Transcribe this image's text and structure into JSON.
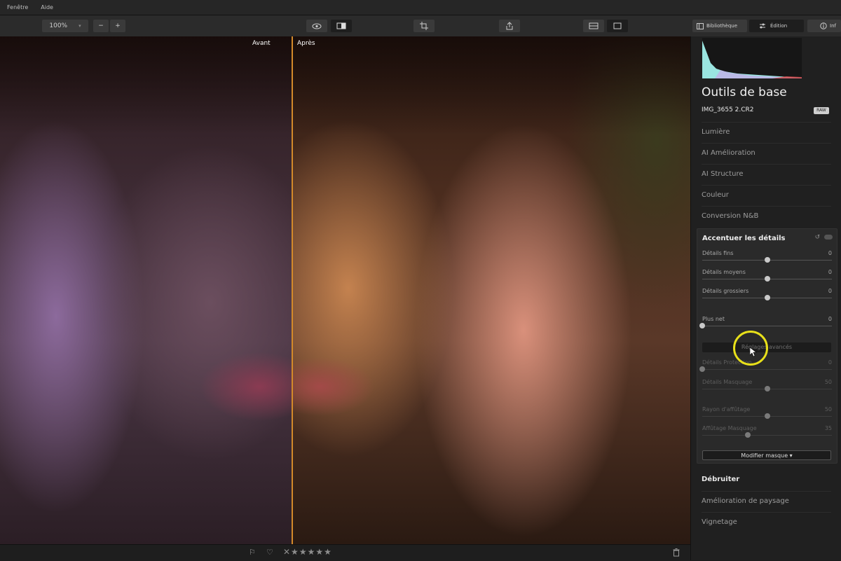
{
  "menu": {
    "items": [
      "Fenêtre",
      "Aide"
    ]
  },
  "toolbar": {
    "zoom_value": "100%",
    "zoom_dropdown_glyph": "▾",
    "zoom_out": "−",
    "zoom_in": "+",
    "tab_library": "Bibliothèque",
    "tab_edit": "Édition",
    "tab_info_partial": "Inf"
  },
  "viewer": {
    "before_label": "Avant",
    "after_label": "Après"
  },
  "bottombar": {
    "rating_stars": "✕★★★★★",
    "flag": "⚐",
    "heart": "♡"
  },
  "panel": {
    "title": "Outils de base",
    "filename": "IMG_3655 2.CR2",
    "raw_badge": "RAW",
    "sections_top": [
      "Lumière",
      "AI Amélioration",
      "AI Structure",
      "Couleur",
      "Conversion N&B"
    ],
    "detail": {
      "title": "Accentuer les détails",
      "sliders": [
        {
          "label": "Détails fins",
          "value": "0",
          "position": 0.5
        },
        {
          "label": "Détails moyens",
          "value": "0",
          "position": 0.5
        },
        {
          "label": "Détails grossiers",
          "value": "0",
          "position": 0.5
        },
        {
          "label": "Plus net",
          "value": "0",
          "position": 0.0
        }
      ],
      "advanced_button": "Réglages avancés",
      "advanced_sliders": [
        {
          "label": "Détails Protection",
          "value": "0",
          "position": 0.0
        },
        {
          "label": "Détails Masquage",
          "value": "50",
          "position": 0.5
        },
        {
          "label": "Rayon d'affûtage",
          "value": "50",
          "position": 0.5
        },
        {
          "label": "Affûtage Masquage",
          "value": "35",
          "position": 0.35
        }
      ],
      "mask_button": "Modifier masque ▾"
    },
    "sections_bottom": [
      "Débruiter",
      "Amélioration de paysage",
      "Vignetage"
    ]
  }
}
